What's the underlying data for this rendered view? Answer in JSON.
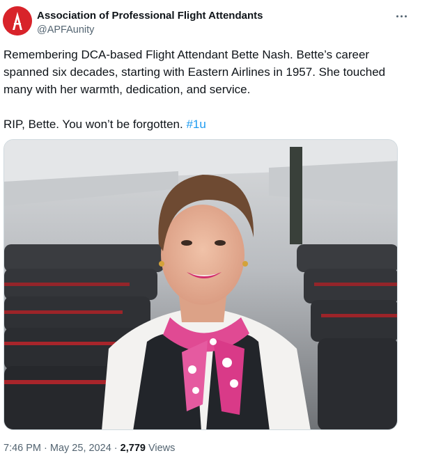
{
  "author": {
    "name": "Association of Professional Flight Attendants",
    "handle": "@APFAunity"
  },
  "tweet": {
    "line1": "Remembering DCA-based Flight Attendant Bette Nash. Bette’s career spanned six decades, starting with Eastern Airlines in 1957. She touched many with her warmth, dedication, and service.",
    "line2_text": "RIP, Bette. You won’t be forgotten. ",
    "hashtag": "#1u"
  },
  "meta": {
    "time": "7:46 PM",
    "separator": " · ",
    "date": "May 25, 2024",
    "views_count": "2,779",
    "views_label": " Views"
  },
  "icons": {
    "avatar": "apfa-logo-icon",
    "more": "more-options-icon"
  },
  "colors": {
    "brand_red": "#d8232a",
    "link_blue": "#1d9bf0",
    "secondary_text": "#536471"
  }
}
